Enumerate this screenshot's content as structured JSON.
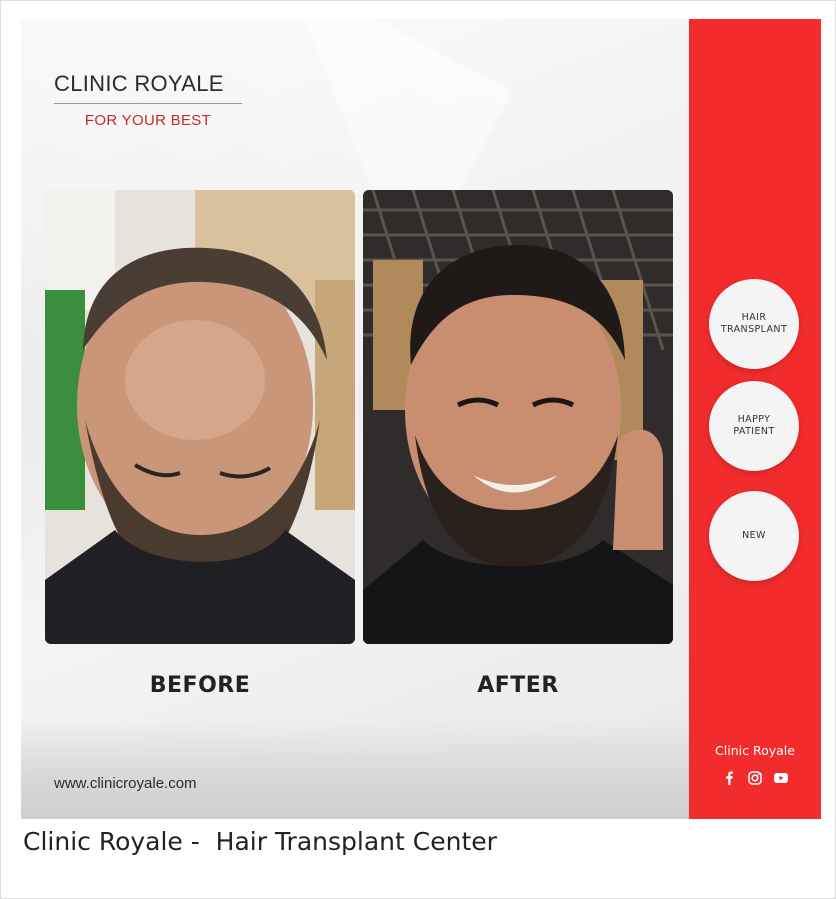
{
  "card": {
    "brand_name": "CLINIC ROYALE",
    "brand_tagline": "FOR YOUR BEST",
    "before_label": "BEFORE",
    "after_label": "AFTER",
    "website": "www.clinicroyale.com",
    "colors": {
      "sidebar": "#f22c2c",
      "tagline": "#c42a2a"
    }
  },
  "sidebar": {
    "badges": [
      {
        "line1": "HAIR",
        "line2": "TRANSPLANT"
      },
      {
        "line1": "HAPPY",
        "line2": "PATIENT"
      },
      {
        "line1": "NEW",
        "line2": ""
      }
    ],
    "brand": "Clinic Royale",
    "social_icons": [
      "facebook-icon",
      "instagram-icon",
      "youtube-icon"
    ]
  },
  "caption": "Clinic Royale -  Hair Transplant Center"
}
